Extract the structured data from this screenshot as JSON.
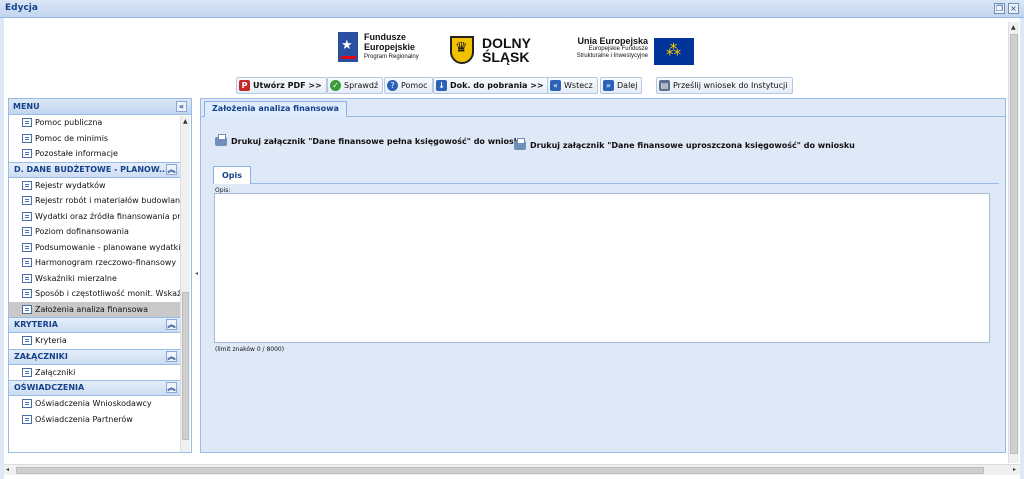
{
  "window": {
    "title": "Edycja",
    "restore_icon": "restore-icon",
    "close_icon": "close-icon"
  },
  "logos": {
    "fe_line1": "Fundusze",
    "fe_line2": "Europejskie",
    "fe_line3": "Program Regionalny",
    "ds_line1": "DOLNY",
    "ds_line2": "ŚLĄSK",
    "ue_line1": "Unia Europejska",
    "ue_line2": "Europejskie Fundusze",
    "ue_line3": "Strukturalne i Inwestycyjne"
  },
  "toolbar": {
    "pdf": "Utwórz PDF >>",
    "check": "Sprawdź",
    "help": "Pomoc",
    "docs": "Dok. do pobrania >>",
    "back": "Wstecz",
    "next": "Dalej",
    "send": "Prześlij wniosek do Instytucji"
  },
  "sidebar": {
    "menu_title": "MENU",
    "top_items": [
      {
        "label": "Pomoc publiczna"
      },
      {
        "label": "Pomoc de minimis"
      },
      {
        "label": "Pozostałe informacje"
      }
    ],
    "section_d": {
      "title": "D. DANE BUDŻETOWE - PLANOW...",
      "items": [
        {
          "label": "Rejestr wydatków"
        },
        {
          "label": "Rejestr robót i materiałów budowlanyc"
        },
        {
          "label": "Wydatki oraz źródła finansowania proj"
        },
        {
          "label": "Poziom dofinansowania"
        },
        {
          "label": "Podsumowanie - planowane wydatki w"
        },
        {
          "label": "Harmonogram rzeczowo-finansowy"
        },
        {
          "label": "Wskaźniki mierzalne"
        },
        {
          "label": "Sposób i częstotliwość monit. Wskaźni"
        },
        {
          "label": "Założenia analiza finansowa"
        }
      ]
    },
    "section_kryteria": {
      "title": "KRYTERIA",
      "items": [
        {
          "label": "Kryteria"
        }
      ]
    },
    "section_zalaczniki": {
      "title": "ZAŁĄCZNIKI",
      "items": [
        {
          "label": "Załączniki"
        }
      ]
    },
    "section_oswiadczenia": {
      "title": "OŚWIADCZENIA",
      "items": [
        {
          "label": "Oświadczenia Wnioskodawcy"
        },
        {
          "label": "Oświadczenia Partnerów"
        }
      ]
    }
  },
  "main": {
    "tab_title": "Założenia analiza finansowa",
    "print_full": "Drukuj załącznik \"Dane finansowe pełna księgowość\" do wniosku",
    "print_simple": "Drukuj załącznik \"Dane finansowe uproszczona księgowość\" do wniosku",
    "inner_tab": "Opis",
    "opis_label": "Opis:",
    "opis_value": "",
    "limit_text": "(limit znaków 0 / 8000)"
  }
}
